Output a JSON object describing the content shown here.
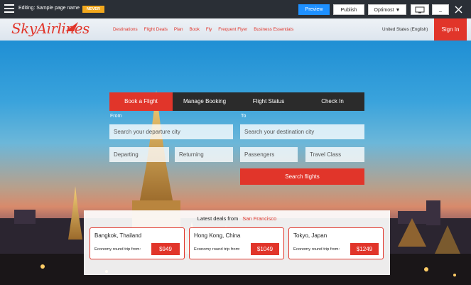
{
  "editor": {
    "editing_label": "Editing: Sample page name",
    "badge": "NEVER",
    "preview": "Preview",
    "publish": "Publish",
    "optimost": "Optimost ▼",
    "minimize": "_",
    "icons": {
      "menu": "hamburger-icon",
      "monitor": "monitor-icon",
      "close": "close-icon"
    }
  },
  "header": {
    "logo": "SkyAirlines",
    "nav": [
      "Destinations",
      "Flight Deals",
      "Plan",
      "Book",
      "Fly",
      "Frequent Flyer",
      "Business Essentials"
    ],
    "locale": "United States (English)",
    "signin": "Sign In"
  },
  "booking": {
    "tabs": [
      "Book a Flight",
      "Manage Booking",
      "Flight Status",
      "Check In"
    ],
    "from_label": "From",
    "to_label": "To",
    "from_placeholder": "Search your departure city",
    "to_placeholder": "Search your destination city",
    "departing": "Departing",
    "returning": "Returning",
    "passengers": "Passengers",
    "travel_class": "Travel Class",
    "search_button": "Search flights"
  },
  "deals": {
    "title": "Latest deals from",
    "origin": "San Francisco",
    "items": [
      {
        "destination": "Bangkok, Thailand",
        "label": "Economy round trip from:",
        "price": "$949"
      },
      {
        "destination": "Hong Kong, China",
        "label": "Economy round trip from:",
        "price": "$1049"
      },
      {
        "destination": "Tokyo, Japan",
        "label": "Economy round trip from:",
        "price": "$1249"
      }
    ]
  },
  "colors": {
    "brand": "#e1352a",
    "editor_bar": "#2a2f36",
    "preview": "#1e90ff",
    "badge": "#f2a81d"
  }
}
